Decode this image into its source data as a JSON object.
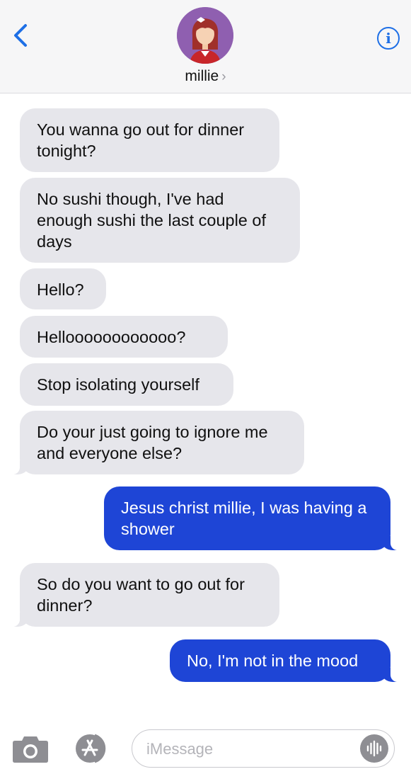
{
  "header": {
    "contact_name": "millie",
    "name_chevron": "›",
    "back_icon": "chevron-left-icon",
    "info_icon": "info-icon",
    "info_glyph": "i",
    "accent_color": "#1e6fe6"
  },
  "messages": [
    {
      "direction": "received",
      "text": "You wanna go out for dinner tonight?"
    },
    {
      "direction": "received",
      "text": "No sushi though, I've had enough sushi the last couple of days"
    },
    {
      "direction": "received",
      "text": "Hello?"
    },
    {
      "direction": "received",
      "text": "Helloooooooooooo?"
    },
    {
      "direction": "received",
      "text": "Stop isolating yourself"
    },
    {
      "direction": "received",
      "text": "Do your just going to ignore me and everyone else?"
    },
    {
      "direction": "sent",
      "text": "Jesus christ millie, I was having a shower"
    },
    {
      "direction": "received",
      "text": "So do you want to go out for dinner?"
    },
    {
      "direction": "sent",
      "text": "No, I'm not in the mood"
    }
  ],
  "colors": {
    "received_bubble": "#e6e6eb",
    "sent_bubble": "#1e45d6"
  },
  "input_bar": {
    "placeholder": "iMessage",
    "camera_icon": "camera-icon",
    "apps_icon": "app-store-icon",
    "audio_icon": "audio-waveform-icon"
  }
}
